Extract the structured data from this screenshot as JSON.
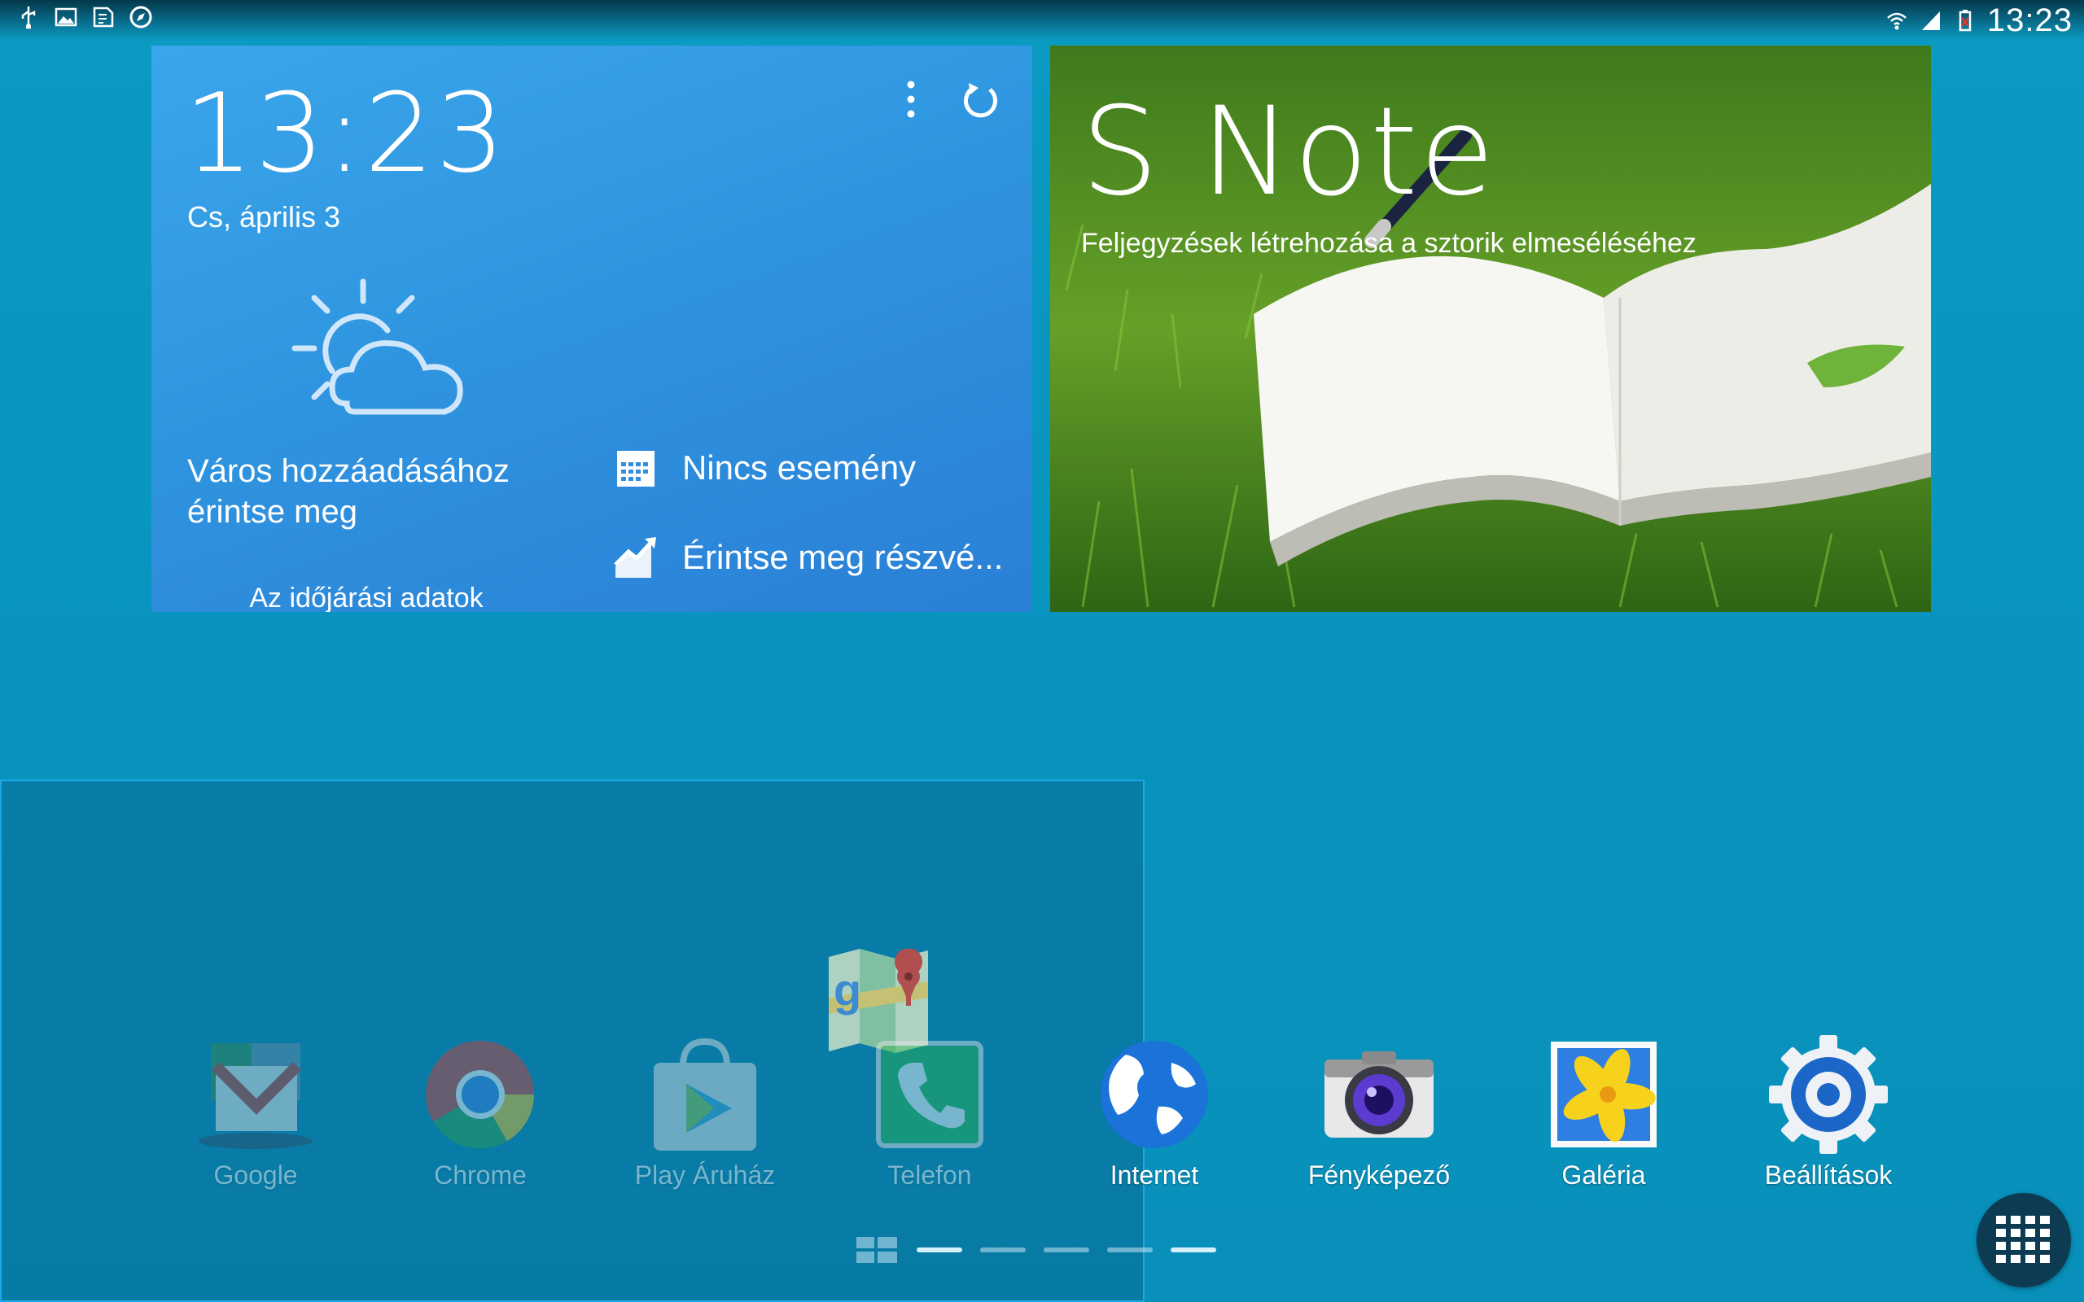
{
  "status_bar": {
    "time": "13:23",
    "left_icons": [
      "usb-icon",
      "image-icon",
      "sim-icon",
      "compass-icon"
    ],
    "right_icons": [
      "wifi-icon",
      "signal-icon",
      "battery-icon"
    ]
  },
  "clock_widget": {
    "time": "13:23",
    "date": "Cs, április 3",
    "weather_city": "Város hozzáadásához érintse meg",
    "weather_note": "Az időjárási adatok pillanatnyilag nem elérhetők",
    "events_label": "Nincs esemény",
    "stocks_label": "Érintse meg részvé..."
  },
  "snote_widget": {
    "title": "S Note",
    "subtitle": "Feljegyzések létrehozása a sztorik elmeséléséhez"
  },
  "apps": [
    {
      "label": "Google",
      "icon": "google-folder-icon"
    },
    {
      "label": "Chrome",
      "icon": "chrome-icon"
    },
    {
      "label": "Play Áruház",
      "icon": "play-store-icon"
    },
    {
      "label": "Telefon",
      "icon": "phone-icon"
    },
    {
      "label": "Internet",
      "icon": "internet-globe-icon"
    },
    {
      "label": "Fényképező",
      "icon": "camera-icon"
    },
    {
      "label": "Galéria",
      "icon": "gallery-icon"
    },
    {
      "label": "Beállítások",
      "icon": "settings-gear-icon"
    }
  ],
  "page_indicator": {
    "pages": 5,
    "current": 0
  },
  "colors": {
    "background": "#0893bd",
    "widget_blue": "#2f95e0",
    "overlay_border": "#1aa8ea"
  }
}
